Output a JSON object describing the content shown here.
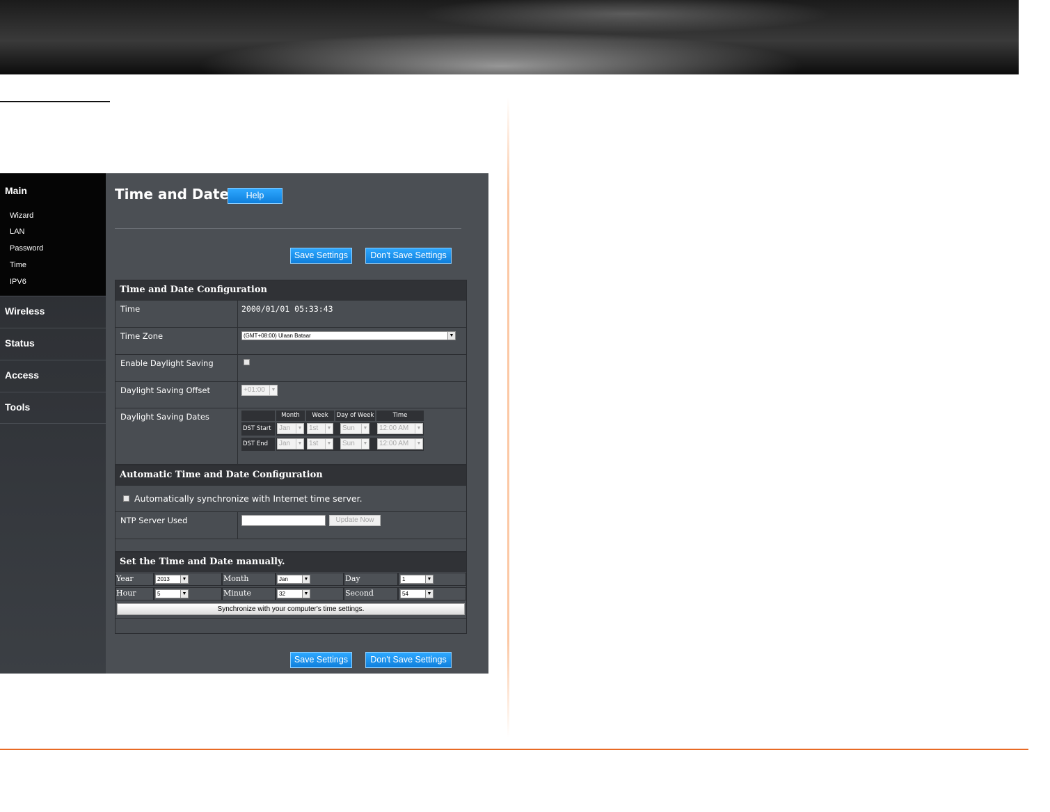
{
  "sidebar": {
    "main_label": "Main",
    "sub_items": [
      "Wizard",
      "LAN",
      "Password",
      "Time",
      "IPV6"
    ],
    "categories": [
      "Wireless",
      "Status",
      "Access",
      "Tools"
    ]
  },
  "page": {
    "title": "Time and Date",
    "help_label": "Help",
    "save_label": "Save Settings",
    "dont_save_label": "Don't Save Settings"
  },
  "config": {
    "section_title": "Time and Date Configuration",
    "time_label": "Time",
    "time_value": "2000/01/01 05:33:43",
    "timezone_label": "Time Zone",
    "timezone_value": "(GMT+08:00) Ulaan Bataar",
    "daylight_label": "Enable Daylight Saving",
    "offset_label": "Daylight Saving Offset",
    "offset_value": "+01:00",
    "dates_label": "Daylight Saving Dates",
    "dst_headers": [
      "Month",
      "Week",
      "Day of Week",
      "Time"
    ],
    "dst_start": {
      "label": "DST Start",
      "month": "Jan",
      "week": "1st",
      "day": "Sun",
      "time": "12:00 AM"
    },
    "dst_end": {
      "label": "DST End",
      "month": "Jan",
      "week": "1st",
      "day": "Sun",
      "time": "12:00 AM"
    }
  },
  "auto": {
    "section_title": "Automatic Time and Date Configuration",
    "sync_label": "Automatically synchronize with Internet time server.",
    "ntp_label": "NTP Server Used",
    "ntp_value": "",
    "update_label": "Update Now"
  },
  "manual": {
    "section_title": "Set the Time and Date manually.",
    "year_label": "Year",
    "year_value": "2013",
    "month_label": "Month",
    "month_value": "Jan",
    "day_label": "Day",
    "day_value": "1",
    "hour_label": "Hour",
    "hour_value": "5",
    "minute_label": "Minute",
    "minute_value": "32",
    "second_label": "Second",
    "second_value": "54",
    "sync_button": "Synchronize with your computer's time settings."
  },
  "colors": {
    "accent_blue": "#1f92f0",
    "footer_line": "#e86a24"
  }
}
